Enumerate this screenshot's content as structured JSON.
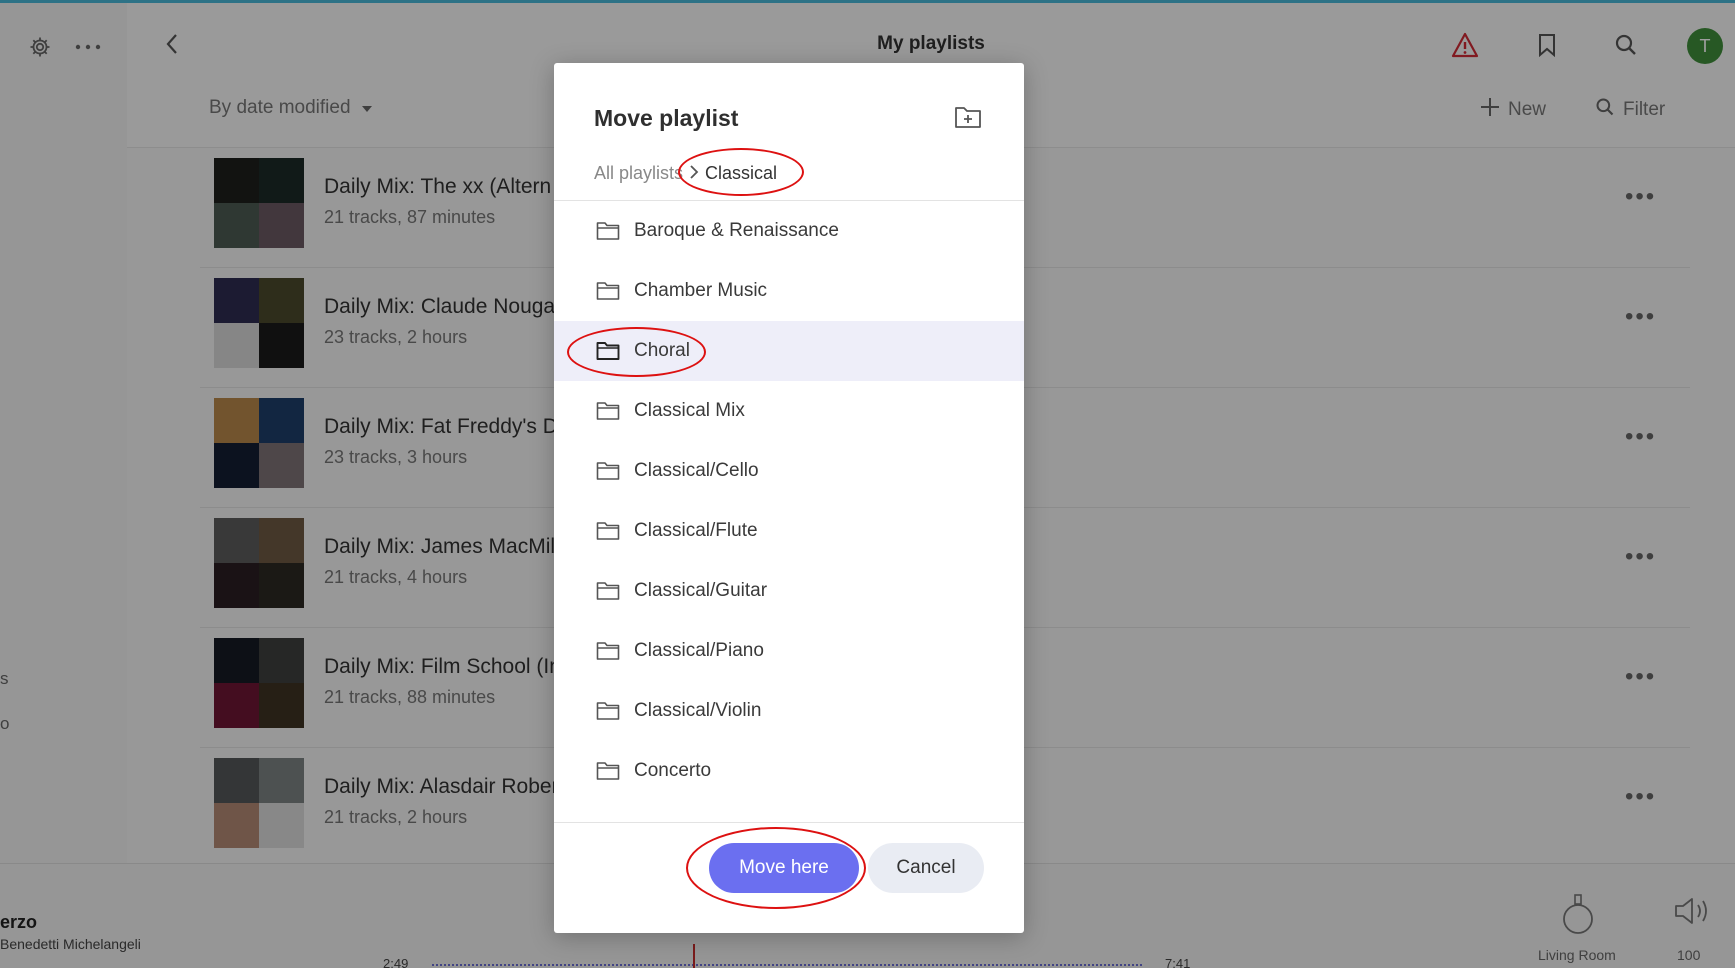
{
  "header": {
    "title": "My playlists",
    "sort_label": "By date modified",
    "new_label": "New",
    "filter_label": "Filter",
    "avatar_letter": "T"
  },
  "playlists": [
    {
      "title": "Daily Mix: The xx (Altern",
      "subtitle": "21 tracks, 87 minutes",
      "thumb_colors": [
        "#1d1f1c",
        "#1c2a27",
        "#4c5b53",
        "#6b5a63"
      ]
    },
    {
      "title": "Daily Mix: Claude Nouga",
      "subtitle": "23 tracks, 2 hours",
      "thumb_colors": [
        "#2e2d52",
        "#4b4a2c",
        "#d9d9d9",
        "#1a1a1a"
      ]
    },
    {
      "title": "Daily Mix: Fat Freddy's D",
      "subtitle": "23 tracks, 3 hours",
      "thumb_colors": [
        "#b9884b",
        "#1e3e6a",
        "#141e33",
        "#7f7377"
      ]
    },
    {
      "title": "Daily Mix: James MacMil",
      "subtitle": "21 tracks, 4 hours",
      "thumb_colors": [
        "#5d5d5d",
        "#6f5a43",
        "#2a1e22",
        "#2d2922"
      ]
    },
    {
      "title": "Daily Mix: Film School (In",
      "subtitle": "21 tracks, 88 minutes",
      "thumb_colors": [
        "#161a25",
        "#3e3f3e",
        "#6e1534",
        "#3e3322"
      ]
    },
    {
      "title": "Daily Mix: Alasdair Rober",
      "subtitle": "21 tracks, 2 hours",
      "thumb_colors": [
        "#55585a",
        "#7c8484",
        "#b48a74",
        "#dcdcdc"
      ]
    }
  ],
  "sidebar": {
    "frag1": "s",
    "frag2": "o"
  },
  "player": {
    "track": "erzo",
    "artist": "Benedetti Michelangeli",
    "elapsed": "2:49",
    "total": "7:41",
    "zone": "Living Room",
    "volume": "100"
  },
  "modal": {
    "title": "Move playlist",
    "breadcrumb_root": "All playlists",
    "breadcrumb_current": "Classical",
    "folders": [
      "Baroque & Renaissance",
      "Chamber Music",
      "Choral",
      "Classical Mix",
      "Classical/Cello",
      "Classical/Flute",
      "Classical/Guitar",
      "Classical/Piano",
      "Classical/Violin",
      "Concerto"
    ],
    "selected_folder": "Choral",
    "move_label": "Move here",
    "cancel_label": "Cancel"
  },
  "colors": {
    "accent": "#6b6ff0",
    "avatar": "#3f8f3a",
    "alert": "#d12b36",
    "annotation": "#dd1111"
  }
}
